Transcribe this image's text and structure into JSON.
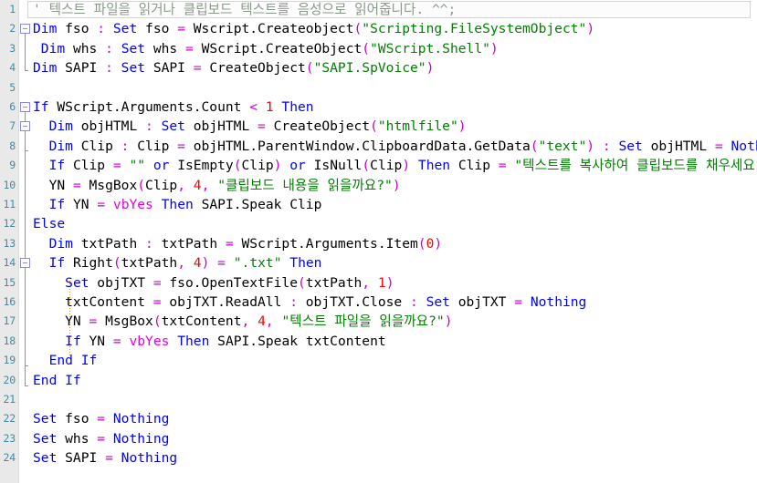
{
  "editor": {
    "language": "VBScript",
    "current_line": 1,
    "gutter_bg": "#e9e9e9",
    "background": "#ffffff",
    "colors": {
      "keyword": "#0000ff",
      "string": "#008000",
      "number": "#ff0000",
      "operator": "#cc00cc",
      "comment": "#8a9a8a",
      "constant": "#e000e0",
      "plain": "#000000",
      "linenumber": "#3c8da4",
      "fold_marker": "#8a8ae0",
      "indent_guide": "#e8901e"
    }
  },
  "lines": [
    {
      "num": "1",
      "text": "' 텍스트 파일을 읽거나 클립보드 텍스트를 음성으로 읽어줍니다. ^^;",
      "tokens": [
        {
          "t": "' 텍스트 파일을 읽거나 클립보드 텍스트를 음성으로 읽어줍니다. ^^;",
          "c": "cmt"
        }
      ]
    },
    {
      "num": "2",
      "text": "Dim fso : Set fso = Wscript.Createobject(\"Scripting.FileSystemObject\")",
      "tokens": [
        {
          "t": "Dim",
          "c": "kw"
        },
        {
          "t": " fso ",
          "c": "pln"
        },
        {
          "t": ":",
          "c": "op"
        },
        {
          "t": " ",
          "c": "pln"
        },
        {
          "t": "Set",
          "c": "kw"
        },
        {
          "t": " fso ",
          "c": "pln"
        },
        {
          "t": "=",
          "c": "op"
        },
        {
          "t": " Wscript.Createobject",
          "c": "pln"
        },
        {
          "t": "(",
          "c": "op"
        },
        {
          "t": "\"Scripting.FileSystemObject\"",
          "c": "str"
        },
        {
          "t": ")",
          "c": "op"
        }
      ]
    },
    {
      "num": "3",
      "text": " Dim whs : Set whs = WScript.CreateObject(\"WScript.Shell\")",
      "tokens": [
        {
          "t": " ",
          "c": "pln"
        },
        {
          "t": "Dim",
          "c": "kw"
        },
        {
          "t": " whs ",
          "c": "pln"
        },
        {
          "t": ":",
          "c": "op"
        },
        {
          "t": " ",
          "c": "pln"
        },
        {
          "t": "Set",
          "c": "kw"
        },
        {
          "t": " whs ",
          "c": "pln"
        },
        {
          "t": "=",
          "c": "op"
        },
        {
          "t": " WScript.CreateObject",
          "c": "pln"
        },
        {
          "t": "(",
          "c": "op"
        },
        {
          "t": "\"WScript.Shell\"",
          "c": "str"
        },
        {
          "t": ")",
          "c": "op"
        }
      ]
    },
    {
      "num": "4",
      "text": "Dim SAPI : Set SAPI = CreateObject(\"SAPI.SpVoice\")",
      "tokens": [
        {
          "t": "Dim",
          "c": "kw"
        },
        {
          "t": " SAPI ",
          "c": "pln"
        },
        {
          "t": ":",
          "c": "op"
        },
        {
          "t": " ",
          "c": "pln"
        },
        {
          "t": "Set",
          "c": "kw"
        },
        {
          "t": " SAPI ",
          "c": "pln"
        },
        {
          "t": "=",
          "c": "op"
        },
        {
          "t": " CreateObject",
          "c": "pln"
        },
        {
          "t": "(",
          "c": "op"
        },
        {
          "t": "\"SAPI.SpVoice\"",
          "c": "str"
        },
        {
          "t": ")",
          "c": "op"
        }
      ]
    },
    {
      "num": "5",
      "text": "",
      "tokens": []
    },
    {
      "num": "6",
      "text": "If WScript.Arguments.Count < 1 Then",
      "tokens": [
        {
          "t": "If",
          "c": "kw"
        },
        {
          "t": " WScript.Arguments.Count ",
          "c": "pln"
        },
        {
          "t": "<",
          "c": "op"
        },
        {
          "t": " ",
          "c": "pln"
        },
        {
          "t": "1",
          "c": "num"
        },
        {
          "t": " ",
          "c": "pln"
        },
        {
          "t": "Then",
          "c": "kw"
        }
      ]
    },
    {
      "num": "7",
      "text": "  Dim objHTML : Set objHTML = CreateObject(\"htmlfile\")",
      "tokens": [
        {
          "t": "  ",
          "c": "pln"
        },
        {
          "t": "Dim",
          "c": "kw"
        },
        {
          "t": " objHTML ",
          "c": "pln"
        },
        {
          "t": ":",
          "c": "op"
        },
        {
          "t": " ",
          "c": "pln"
        },
        {
          "t": "Set",
          "c": "kw"
        },
        {
          "t": " objHTML ",
          "c": "pln"
        },
        {
          "t": "=",
          "c": "op"
        },
        {
          "t": " CreateObject",
          "c": "pln"
        },
        {
          "t": "(",
          "c": "op"
        },
        {
          "t": "\"htmlfile\"",
          "c": "str"
        },
        {
          "t": ")",
          "c": "op"
        }
      ]
    },
    {
      "num": "8",
      "text": "  Dim Clip : Clip = objHTML.ParentWindow.ClipboardData.GetData(\"text\") : Set objHTML = Nothing",
      "tokens": [
        {
          "t": "  ",
          "c": "pln"
        },
        {
          "t": "Dim",
          "c": "kw"
        },
        {
          "t": " Clip ",
          "c": "pln"
        },
        {
          "t": ":",
          "c": "op"
        },
        {
          "t": " Clip ",
          "c": "pln"
        },
        {
          "t": "=",
          "c": "op"
        },
        {
          "t": " objHTML.ParentWindow.ClipboardData.GetData",
          "c": "pln"
        },
        {
          "t": "(",
          "c": "op"
        },
        {
          "t": "\"text\"",
          "c": "str"
        },
        {
          "t": ")",
          "c": "op"
        },
        {
          "t": " ",
          "c": "pln"
        },
        {
          "t": ":",
          "c": "op"
        },
        {
          "t": " ",
          "c": "pln"
        },
        {
          "t": "Set",
          "c": "kw"
        },
        {
          "t": " objHTML ",
          "c": "pln"
        },
        {
          "t": "=",
          "c": "op"
        },
        {
          "t": " ",
          "c": "pln"
        },
        {
          "t": "Nothing",
          "c": "kw"
        }
      ]
    },
    {
      "num": "9",
      "text": "  If Clip = \"\" or IsEmpty(Clip) or IsNull(Clip) Then Clip = \"텍스트를 복사하여 클립보드를 채우세요.\"",
      "tokens": [
        {
          "t": "  ",
          "c": "pln"
        },
        {
          "t": "If",
          "c": "kw"
        },
        {
          "t": " Clip ",
          "c": "pln"
        },
        {
          "t": "=",
          "c": "op"
        },
        {
          "t": " ",
          "c": "pln"
        },
        {
          "t": "\"\"",
          "c": "str"
        },
        {
          "t": " ",
          "c": "pln"
        },
        {
          "t": "or",
          "c": "kw"
        },
        {
          "t": " IsEmpty",
          "c": "pln"
        },
        {
          "t": "(",
          "c": "op"
        },
        {
          "t": "Clip",
          "c": "pln"
        },
        {
          "t": ")",
          "c": "op"
        },
        {
          "t": " ",
          "c": "pln"
        },
        {
          "t": "or",
          "c": "kw"
        },
        {
          "t": " IsNull",
          "c": "pln"
        },
        {
          "t": "(",
          "c": "op"
        },
        {
          "t": "Clip",
          "c": "pln"
        },
        {
          "t": ")",
          "c": "op"
        },
        {
          "t": " ",
          "c": "pln"
        },
        {
          "t": "Then",
          "c": "kw"
        },
        {
          "t": " Clip ",
          "c": "pln"
        },
        {
          "t": "=",
          "c": "op"
        },
        {
          "t": " ",
          "c": "pln"
        },
        {
          "t": "\"텍스트를 복사하여 클립보드를 채우세요.\"",
          "c": "str"
        }
      ]
    },
    {
      "num": "10",
      "text": "  YN = MsgBox(Clip, 4, \"클립보드 내용을 읽을까요?\")",
      "tokens": [
        {
          "t": "  YN ",
          "c": "pln"
        },
        {
          "t": "=",
          "c": "op"
        },
        {
          "t": " MsgBox",
          "c": "pln"
        },
        {
          "t": "(",
          "c": "op"
        },
        {
          "t": "Clip",
          "c": "pln"
        },
        {
          "t": ",",
          "c": "op"
        },
        {
          "t": " ",
          "c": "pln"
        },
        {
          "t": "4",
          "c": "num"
        },
        {
          "t": ",",
          "c": "op"
        },
        {
          "t": " ",
          "c": "pln"
        },
        {
          "t": "\"클립보드 내용을 읽을까요?\"",
          "c": "str"
        },
        {
          "t": ")",
          "c": "op"
        }
      ]
    },
    {
      "num": "11",
      "text": "  If YN = vbYes Then SAPI.Speak Clip",
      "tokens": [
        {
          "t": "  ",
          "c": "pln"
        },
        {
          "t": "If",
          "c": "kw"
        },
        {
          "t": " YN ",
          "c": "pln"
        },
        {
          "t": "=",
          "c": "op"
        },
        {
          "t": " ",
          "c": "pln"
        },
        {
          "t": "vbYes",
          "c": "cst"
        },
        {
          "t": " ",
          "c": "pln"
        },
        {
          "t": "Then",
          "c": "kw"
        },
        {
          "t": " SAPI.Speak Clip",
          "c": "pln"
        }
      ]
    },
    {
      "num": "12",
      "text": "Else",
      "tokens": [
        {
          "t": "Else",
          "c": "kw"
        }
      ]
    },
    {
      "num": "13",
      "text": "  Dim txtPath : txtPath = WScript.Arguments.Item(0)",
      "tokens": [
        {
          "t": "  ",
          "c": "pln"
        },
        {
          "t": "Dim",
          "c": "kw"
        },
        {
          "t": " txtPath ",
          "c": "pln"
        },
        {
          "t": ":",
          "c": "op"
        },
        {
          "t": " txtPath ",
          "c": "pln"
        },
        {
          "t": "=",
          "c": "op"
        },
        {
          "t": " WScript.Arguments.Item",
          "c": "pln"
        },
        {
          "t": "(",
          "c": "op"
        },
        {
          "t": "0",
          "c": "num"
        },
        {
          "t": ")",
          "c": "op"
        }
      ]
    },
    {
      "num": "14",
      "text": "  If Right(txtPath, 4) = \".txt\" Then",
      "tokens": [
        {
          "t": "  ",
          "c": "pln"
        },
        {
          "t": "If",
          "c": "kw"
        },
        {
          "t": " Right",
          "c": "pln"
        },
        {
          "t": "(",
          "c": "op"
        },
        {
          "t": "txtPath",
          "c": "pln"
        },
        {
          "t": ",",
          "c": "op"
        },
        {
          "t": " ",
          "c": "pln"
        },
        {
          "t": "4",
          "c": "num"
        },
        {
          "t": ")",
          "c": "op"
        },
        {
          "t": " ",
          "c": "pln"
        },
        {
          "t": "=",
          "c": "op"
        },
        {
          "t": " ",
          "c": "pln"
        },
        {
          "t": "\".txt\"",
          "c": "str"
        },
        {
          "t": " ",
          "c": "pln"
        },
        {
          "t": "Then",
          "c": "kw"
        }
      ]
    },
    {
      "num": "15",
      "text": "    Set objTXT = fso.OpenTextFile(txtPath, 1)",
      "tokens": [
        {
          "t": "    ",
          "c": "pln"
        },
        {
          "t": "Set",
          "c": "kw"
        },
        {
          "t": " objTXT ",
          "c": "pln"
        },
        {
          "t": "=",
          "c": "op"
        },
        {
          "t": " fso.OpenTextFile",
          "c": "pln"
        },
        {
          "t": "(",
          "c": "op"
        },
        {
          "t": "txtPath",
          "c": "pln"
        },
        {
          "t": ",",
          "c": "op"
        },
        {
          "t": " ",
          "c": "pln"
        },
        {
          "t": "1",
          "c": "num"
        },
        {
          "t": ")",
          "c": "op"
        }
      ]
    },
    {
      "num": "16",
      "text": "    txtContent = objTXT.ReadAll : objTXT.Close : Set objTXT = Nothing",
      "tokens": [
        {
          "t": "    txtContent ",
          "c": "pln"
        },
        {
          "t": "=",
          "c": "op"
        },
        {
          "t": " objTXT.ReadAll ",
          "c": "pln"
        },
        {
          "t": ":",
          "c": "op"
        },
        {
          "t": " objTXT.Close ",
          "c": "pln"
        },
        {
          "t": ":",
          "c": "op"
        },
        {
          "t": " ",
          "c": "pln"
        },
        {
          "t": "Set",
          "c": "kw"
        },
        {
          "t": " objTXT ",
          "c": "pln"
        },
        {
          "t": "=",
          "c": "op"
        },
        {
          "t": " ",
          "c": "pln"
        },
        {
          "t": "Nothing",
          "c": "kw"
        }
      ]
    },
    {
      "num": "17",
      "text": "    YN = MsgBox(txtContent, 4, \"텍스트 파일을 읽을까요?\")",
      "tokens": [
        {
          "t": "    YN ",
          "c": "pln"
        },
        {
          "t": "=",
          "c": "op"
        },
        {
          "t": " MsgBox",
          "c": "pln"
        },
        {
          "t": "(",
          "c": "op"
        },
        {
          "t": "txtContent",
          "c": "pln"
        },
        {
          "t": ",",
          "c": "op"
        },
        {
          "t": " ",
          "c": "pln"
        },
        {
          "t": "4",
          "c": "num"
        },
        {
          "t": ",",
          "c": "op"
        },
        {
          "t": " ",
          "c": "pln"
        },
        {
          "t": "\"텍스트 파일을 읽을까요?\"",
          "c": "str"
        },
        {
          "t": ")",
          "c": "op"
        }
      ]
    },
    {
      "num": "18",
      "text": "    If YN = vbYes Then SAPI.Speak txtContent",
      "tokens": [
        {
          "t": "    ",
          "c": "pln"
        },
        {
          "t": "If",
          "c": "kw"
        },
        {
          "t": " YN ",
          "c": "pln"
        },
        {
          "t": "=",
          "c": "op"
        },
        {
          "t": " ",
          "c": "pln"
        },
        {
          "t": "vbYes",
          "c": "cst"
        },
        {
          "t": " ",
          "c": "pln"
        },
        {
          "t": "Then",
          "c": "kw"
        },
        {
          "t": " SAPI.Speak txtContent",
          "c": "pln"
        }
      ]
    },
    {
      "num": "19",
      "text": "  End If",
      "tokens": [
        {
          "t": "  ",
          "c": "pln"
        },
        {
          "t": "End If",
          "c": "kw"
        }
      ]
    },
    {
      "num": "20",
      "text": "End If",
      "tokens": [
        {
          "t": "End If",
          "c": "kw"
        }
      ]
    },
    {
      "num": "21",
      "text": "",
      "tokens": []
    },
    {
      "num": "22",
      "text": "Set fso = Nothing",
      "tokens": [
        {
          "t": "Set",
          "c": "kw"
        },
        {
          "t": " fso ",
          "c": "pln"
        },
        {
          "t": "=",
          "c": "op"
        },
        {
          "t": " ",
          "c": "pln"
        },
        {
          "t": "Nothing",
          "c": "kw"
        }
      ]
    },
    {
      "num": "23",
      "text": "Set whs = Nothing",
      "tokens": [
        {
          "t": "Set",
          "c": "kw"
        },
        {
          "t": " whs ",
          "c": "pln"
        },
        {
          "t": "=",
          "c": "op"
        },
        {
          "t": " ",
          "c": "pln"
        },
        {
          "t": "Nothing",
          "c": "kw"
        }
      ]
    },
    {
      "num": "24",
      "text": "Set SAPI = Nothing",
      "tokens": [
        {
          "t": "Set",
          "c": "kw"
        },
        {
          "t": " SAPI ",
          "c": "pln"
        },
        {
          "t": "=",
          "c": "op"
        },
        {
          "t": " ",
          "c": "pln"
        },
        {
          "t": "Nothing",
          "c": "kw"
        }
      ]
    }
  ],
  "fold_markers": [
    {
      "line": 2,
      "type": "box"
    },
    {
      "line": 4,
      "type": "end"
    },
    {
      "line": 6,
      "type": "box"
    },
    {
      "line": 7,
      "type": "box"
    },
    {
      "line": 8,
      "type": "tick"
    },
    {
      "line": 14,
      "type": "box"
    },
    {
      "line": 19,
      "type": "tick"
    },
    {
      "line": 20,
      "type": "end"
    }
  ]
}
